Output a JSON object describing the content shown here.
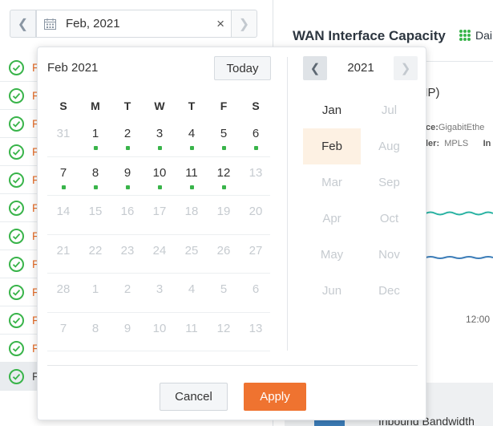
{
  "toolbar": {
    "prev_icon": "chevron-left-icon",
    "next_icon": "chevron-right-icon",
    "calendar_icon": "calendar-icon",
    "date_value": "Feb, 2021",
    "clear_glyph": "×"
  },
  "sidebar": {
    "rows": [
      {
        "label": "F",
        "selected": false
      },
      {
        "label": "F",
        "selected": false
      },
      {
        "label": "F",
        "selected": false
      },
      {
        "label": "F",
        "selected": false
      },
      {
        "label": "F",
        "selected": false
      },
      {
        "label": "F",
        "selected": false
      },
      {
        "label": "F",
        "selected": false
      },
      {
        "label": "F",
        "selected": false
      },
      {
        "label": "F",
        "selected": false
      },
      {
        "label": "F",
        "selected": false
      },
      {
        "label": "F",
        "selected": false
      },
      {
        "label": "F",
        "selected": true
      }
    ]
  },
  "panel": {
    "title": "WAN Interface Capacity",
    "view_label": "Dai",
    "subtitle_fragment": "MP)",
    "meta_interface_key": "ce:",
    "meta_interface_val": "GigabitEthe",
    "meta_type_key": "ler:",
    "meta_type_val": "MPLS",
    "meta_extra": "In",
    "time_tick": "12:00",
    "legend_label": "Inbound Bandwidth",
    "colors": {
      "teal": "#2bb3a3",
      "blue": "#3c7db8",
      "accent": "#ef7330",
      "ok": "#39b44a"
    }
  },
  "picker": {
    "month_label": "Feb 2021",
    "today_label": "Today",
    "weekdays": [
      "S",
      "M",
      "T",
      "W",
      "T",
      "F",
      "S"
    ],
    "weeks": [
      [
        {
          "d": "31",
          "m": true,
          "dot": false
        },
        {
          "d": "1",
          "m": false,
          "dot": true
        },
        {
          "d": "2",
          "m": false,
          "dot": true
        },
        {
          "d": "3",
          "m": false,
          "dot": true
        },
        {
          "d": "4",
          "m": false,
          "dot": true
        },
        {
          "d": "5",
          "m": false,
          "dot": true
        },
        {
          "d": "6",
          "m": false,
          "dot": true
        }
      ],
      [
        {
          "d": "7",
          "m": false,
          "dot": true
        },
        {
          "d": "8",
          "m": false,
          "dot": true
        },
        {
          "d": "9",
          "m": false,
          "dot": true
        },
        {
          "d": "10",
          "m": false,
          "dot": true
        },
        {
          "d": "11",
          "m": false,
          "dot": true
        },
        {
          "d": "12",
          "m": false,
          "dot": true
        },
        {
          "d": "13",
          "m": true,
          "dot": false
        }
      ],
      [
        {
          "d": "14",
          "m": true,
          "dot": false
        },
        {
          "d": "15",
          "m": true,
          "dot": false
        },
        {
          "d": "16",
          "m": true,
          "dot": false
        },
        {
          "d": "17",
          "m": true,
          "dot": false
        },
        {
          "d": "18",
          "m": true,
          "dot": false
        },
        {
          "d": "19",
          "m": true,
          "dot": false
        },
        {
          "d": "20",
          "m": true,
          "dot": false
        }
      ],
      [
        {
          "d": "21",
          "m": true,
          "dot": false
        },
        {
          "d": "22",
          "m": true,
          "dot": false
        },
        {
          "d": "23",
          "m": true,
          "dot": false
        },
        {
          "d": "24",
          "m": true,
          "dot": false
        },
        {
          "d": "25",
          "m": true,
          "dot": false
        },
        {
          "d": "26",
          "m": true,
          "dot": false
        },
        {
          "d": "27",
          "m": true,
          "dot": false
        }
      ],
      [
        {
          "d": "28",
          "m": true,
          "dot": false
        },
        {
          "d": "1",
          "m": true,
          "dot": false
        },
        {
          "d": "2",
          "m": true,
          "dot": false
        },
        {
          "d": "3",
          "m": true,
          "dot": false
        },
        {
          "d": "4",
          "m": true,
          "dot": false
        },
        {
          "d": "5",
          "m": true,
          "dot": false
        },
        {
          "d": "6",
          "m": true,
          "dot": false
        }
      ],
      [
        {
          "d": "7",
          "m": true,
          "dot": false
        },
        {
          "d": "8",
          "m": true,
          "dot": false
        },
        {
          "d": "9",
          "m": true,
          "dot": false
        },
        {
          "d": "10",
          "m": true,
          "dot": false
        },
        {
          "d": "11",
          "m": true,
          "dot": false
        },
        {
          "d": "12",
          "m": true,
          "dot": false
        },
        {
          "d": "13",
          "m": true,
          "dot": false
        }
      ]
    ],
    "year_label": "2021",
    "months": [
      {
        "label": "Jan",
        "enabled": true,
        "selected": false
      },
      {
        "label": "Jul",
        "enabled": false,
        "selected": false
      },
      {
        "label": "Feb",
        "enabled": true,
        "selected": true
      },
      {
        "label": "Aug",
        "enabled": false,
        "selected": false
      },
      {
        "label": "Mar",
        "enabled": false,
        "selected": false
      },
      {
        "label": "Sep",
        "enabled": false,
        "selected": false
      },
      {
        "label": "Apr",
        "enabled": false,
        "selected": false
      },
      {
        "label": "Oct",
        "enabled": false,
        "selected": false
      },
      {
        "label": "May",
        "enabled": false,
        "selected": false
      },
      {
        "label": "Nov",
        "enabled": false,
        "selected": false
      },
      {
        "label": "Jun",
        "enabled": false,
        "selected": false
      },
      {
        "label": "Dec",
        "enabled": false,
        "selected": false
      }
    ],
    "cancel_label": "Cancel",
    "apply_label": "Apply"
  }
}
